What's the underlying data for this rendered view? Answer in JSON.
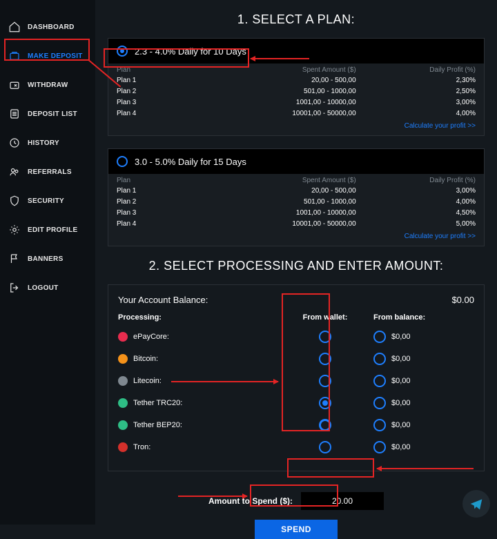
{
  "sidebar": {
    "items": [
      {
        "label": "DASHBOARD"
      },
      {
        "label": "MAKE DEPOSIT"
      },
      {
        "label": "WITHDRAW"
      },
      {
        "label": "DEPOSIT LIST"
      },
      {
        "label": "HISTORY"
      },
      {
        "label": "REFERRALS"
      },
      {
        "label": "SECURITY"
      },
      {
        "label": "EDIT PROFILE"
      },
      {
        "label": "BANNERS"
      },
      {
        "label": "LOGOUT"
      }
    ]
  },
  "sections": {
    "select_plan": "1. SELECT A PLAN:",
    "select_processing": "2. SELECT PROCESSING AND ENTER AMOUNT:"
  },
  "plan_headers": {
    "plan": "Plan",
    "spent": "Spent Amount ($)",
    "profit": "Daily Profit (%)"
  },
  "plans": [
    {
      "title": "2.3 - 4.0% Daily for 10 Days",
      "rows": [
        {
          "name": "Plan 1",
          "spent": "20,00 - 500,00",
          "profit": "2,30%"
        },
        {
          "name": "Plan 2",
          "spent": "501,00 - 1000,00",
          "profit": "2,50%"
        },
        {
          "name": "Plan 3",
          "spent": "1001,00 - 10000,00",
          "profit": "3,00%"
        },
        {
          "name": "Plan 4",
          "spent": "10001,00 - 50000,00",
          "profit": "4,00%"
        }
      ]
    },
    {
      "title": "3.0 - 5.0% Daily for 15 Days",
      "rows": [
        {
          "name": "Plan 1",
          "spent": "20,00 - 500,00",
          "profit": "3,00%"
        },
        {
          "name": "Plan 2",
          "spent": "501,00 - 1000,00",
          "profit": "4,00%"
        },
        {
          "name": "Plan 3",
          "spent": "1001,00 - 10000,00",
          "profit": "4,50%"
        },
        {
          "name": "Plan 4",
          "spent": "10001,00 - 50000,00",
          "profit": "5,00%"
        }
      ]
    }
  ],
  "calc_link": "Calculate your profit >>",
  "processing": {
    "balance_label": "Your Account Balance:",
    "balance_value": "$0.00",
    "col_processing": "Processing:",
    "col_wallet": "From wallet:",
    "col_balance": "From balance:",
    "rows": [
      {
        "name": "ePayCore:",
        "bal": "$0,00"
      },
      {
        "name": "Bitcoin:",
        "bal": "$0,00"
      },
      {
        "name": "Litecoin:",
        "bal": "$0,00"
      },
      {
        "name": "Tether TRC20:",
        "bal": "$0,00"
      },
      {
        "name": "Tether BEP20:",
        "bal": "$0,00"
      },
      {
        "name": "Tron:",
        "bal": "$0,00"
      }
    ]
  },
  "amount": {
    "label": "Amount to Spend ($):",
    "value": "20.00",
    "button": "SPEND"
  }
}
